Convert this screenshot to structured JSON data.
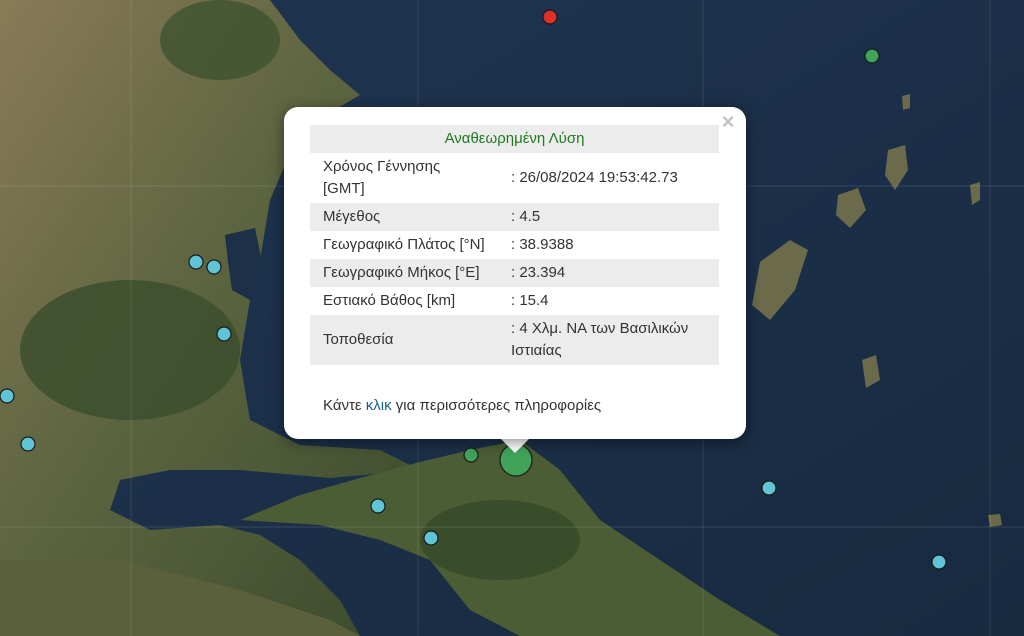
{
  "popup": {
    "title": "Αναθεωρημένη Λύση",
    "rows": [
      {
        "key": "Χρόνος Γέννησης [GMT]",
        "value": ": 26/08/2024 19:53:42.73"
      },
      {
        "key": "Μέγεθος",
        "value": ": 4.5"
      },
      {
        "key": "Γεωγραφικό Πλάτος [°N]",
        "value": ": 38.9388"
      },
      {
        "key": "Γεωγραφικό Μήκος [°E]",
        "value": ": 23.394"
      },
      {
        "key": "Εστιακό Βάθος [km]",
        "value": ": 15.4"
      },
      {
        "key": "Τοποθεσία",
        "value": ": 4 Χλμ. ΝΑ των Βασιλικών Ιστιαίας"
      }
    ],
    "more_prefix": "Κάντε",
    "more_link": "κλικ",
    "more_suffix": "για περισσότερες πληροφορίες",
    "close_symbol": "×"
  },
  "map": {
    "colors": {
      "sea": "#1b2e45",
      "land": "#4e5a35",
      "land_dark": "#36472a",
      "land_light": "#8a7c5c",
      "marker_red": "#e0302a",
      "marker_green": "#3fa35a",
      "marker_cyan": "#5fc4d6"
    },
    "markers": [
      {
        "id": "recent",
        "color": "red"
      },
      {
        "id": "m2",
        "color": "green"
      },
      {
        "id": "m3",
        "color": "cyan"
      },
      {
        "id": "m4",
        "color": "cyan"
      },
      {
        "id": "m5",
        "color": "cyan"
      },
      {
        "id": "m6",
        "color": "cyan"
      },
      {
        "id": "m7",
        "color": "cyan"
      },
      {
        "id": "m8",
        "color": "green"
      },
      {
        "id": "selected-event",
        "color": "green"
      },
      {
        "id": "m10",
        "color": "cyan"
      },
      {
        "id": "m11",
        "color": "cyan"
      },
      {
        "id": "m12",
        "color": "cyan"
      },
      {
        "id": "m13",
        "color": "cyan"
      }
    ]
  }
}
